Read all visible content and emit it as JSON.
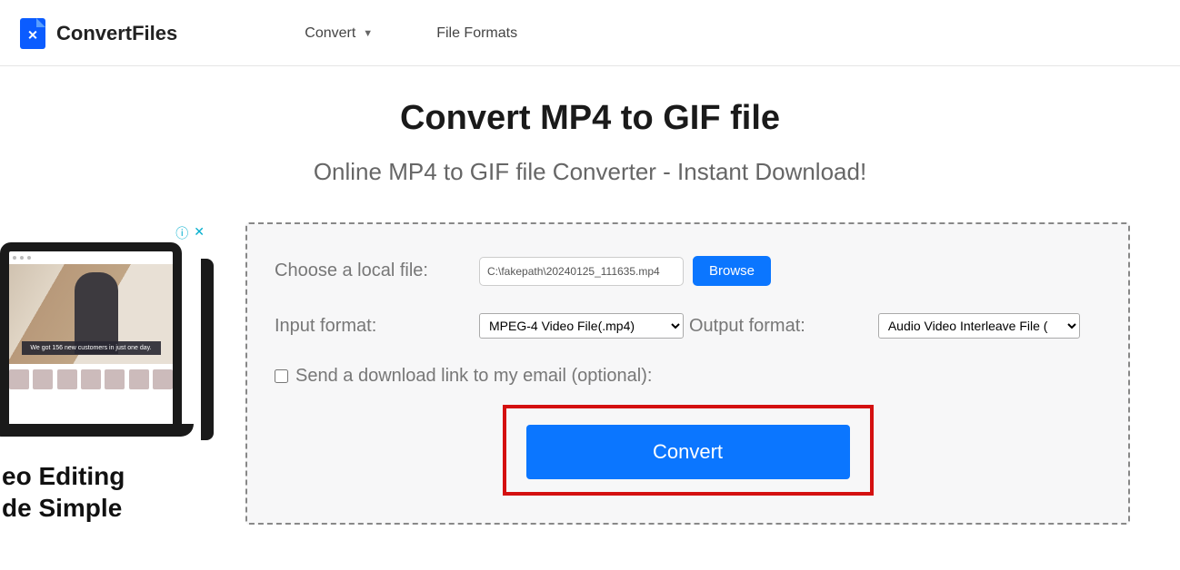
{
  "brand": "ConvertFiles",
  "nav": {
    "convert": "Convert",
    "formats": "File Formats"
  },
  "hero": {
    "title": "Convert MP4 to GIF file",
    "subtitle": "Online MP4 to GIF file Converter - Instant Download!"
  },
  "ad": {
    "caption": "We got 156 new customers in just one day.",
    "line1": "eo Editing",
    "line2": "de Simple"
  },
  "form": {
    "choose_label": "Choose a local file:",
    "file_value": "C:\\fakepath\\20240125_111635.mp4",
    "browse_label": "Browse",
    "input_format_label": "Input format:",
    "input_select_value": "MPEG-4 Video File(.mp4)",
    "output_format_label": "Output format:",
    "output_select_value": "Audio Video Interleave File (",
    "email_label": "Send a download link to my email (optional):",
    "convert_label": "Convert"
  }
}
